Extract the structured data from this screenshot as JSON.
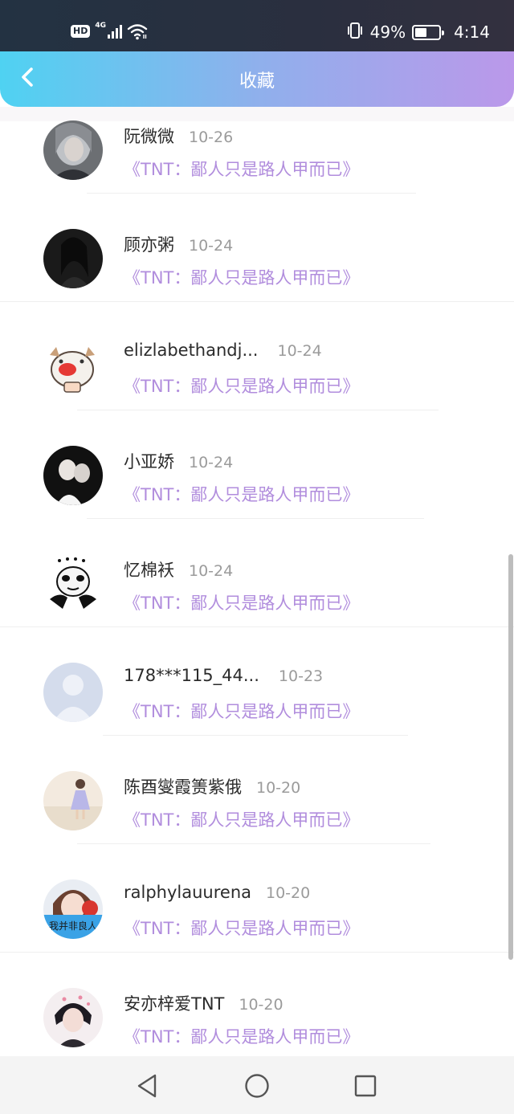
{
  "status_bar": {
    "hd": "HD",
    "network": "4G",
    "battery_percent": "49%",
    "battery_level": 0.49,
    "time": "4:14"
  },
  "header": {
    "title": "收藏",
    "back_icon": "chevron-left-icon",
    "gradient": [
      "#4fd2f2",
      "#bb98ea"
    ]
  },
  "favorites": [
    {
      "username": "阮微微",
      "date": "10-26",
      "title": "《TNT：鄙人只是路人甲而已》"
    },
    {
      "username": "顾亦粥",
      "date": "10-24",
      "title": "《TNT：鄙人只是路人甲而已》"
    },
    {
      "username": "elizlabethandj...",
      "date": "10-24",
      "title": "《TNT：鄙人只是路人甲而已》"
    },
    {
      "username": "小亚娇",
      "date": "10-24",
      "title": "《TNT：鄙人只是路人甲而已》"
    },
    {
      "username": "忆棉袄",
      "date": "10-24",
      "title": "《TNT：鄙人只是路人甲而已》"
    },
    {
      "username": "178***115_44...",
      "date": "10-23",
      "title": "《TNT：鄙人只是路人甲而已》"
    },
    {
      "username": "陈酉燮霞箦紫俄",
      "date": "10-20",
      "title": "《TNT：鄙人只是路人甲而已》"
    },
    {
      "username": "ralphylauurena",
      "date": "10-20",
      "title": "《TNT：鄙人只是路人甲而已》",
      "avatar_caption": "我并非良人"
    },
    {
      "username": "安亦梓爱TNT",
      "date": "10-20",
      "title": "《TNT：鄙人只是路人甲而已》"
    }
  ],
  "colors": {
    "title_purple": "#b18ddd",
    "username": "#2b2b2b",
    "date_gray": "#9b9b9b"
  },
  "nav": {
    "back_icon": "triangle-back-icon",
    "home_icon": "circle-home-icon",
    "recents_icon": "square-recents-icon"
  }
}
